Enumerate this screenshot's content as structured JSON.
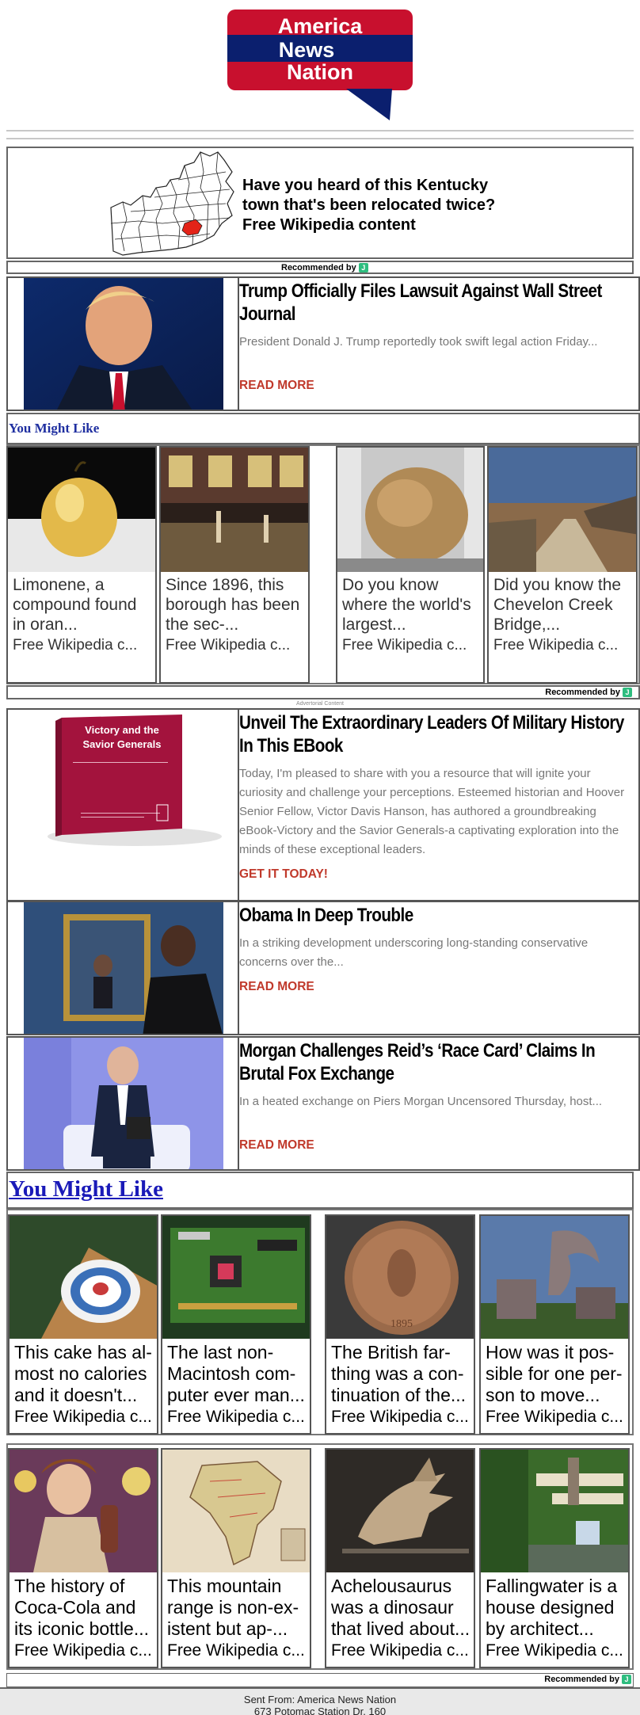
{
  "logo": {
    "line1": "America",
    "line2": "News",
    "line3": "Nation",
    "colors": {
      "red": "#c8102e",
      "navy": "#0b1f6e"
    }
  },
  "promo": {
    "title_line1": "Have you heard of this Kentucky",
    "title_line2": "town that's been relocated twice?",
    "title_line3": "Free Wikipedia content"
  },
  "recommended_by": "Recommended by",
  "articles": [
    {
      "title": "Trump Officially Files Lawsuit Against Wall Street Journal",
      "desc": "President Donald J. Trump reportedly took swift legal action Friday...",
      "cta": "READ MORE"
    }
  ],
  "you_might_like_small": "You Might Like",
  "row1_cards": [
    {
      "text": "Limonene, a compound found in oran...",
      "source": "Free Wikipedia c..."
    },
    {
      "text": "Since 1896, this borough has been the sec-...",
      "source": "Free Wikipedia c..."
    },
    {
      "text": "Do you know where the world's largest...",
      "source": "Free Wikipedia c..."
    },
    {
      "text": "Did you know the Chevelon Creek Bridge,...",
      "source": "Free Wikipedia c..."
    }
  ],
  "advertorial": "Advertorial Content",
  "sponsored": [
    {
      "title": "Unveil The Extraordinary Leaders Of Military History In This EBook",
      "desc": "Today, I'm pleased to share with you a resource that will ignite your curiosity and challenge your perceptions. Esteemed historian and Hoover Senior Fellow, Victor Davis Hanson, has authored a groundbreaking eBook-Victory and the Savior Generals-a captivating exploration into the minds of these exceptional leaders.",
      "cta": "GET IT TODAY!",
      "book_title": "Victory and the Savior Generals"
    },
    {
      "title": "Obama In Deep Trouble",
      "desc": "In a striking development underscoring long-standing conservative concerns over the...",
      "cta": "READ MORE"
    },
    {
      "title": "Morgan Challenges Reid’s ‘Race Card’ Claims In Brutal Fox Exchange",
      "desc": "In a heated exchange on Piers Morgan Uncensored Thursday, host...",
      "cta": "READ MORE"
    }
  ],
  "you_might_like_big": "You Might Like",
  "row2_cards": [
    {
      "text": "This cake has al-most no calories and it doesn't...",
      "source": "Free Wikipedia c..."
    },
    {
      "text": "The last non-Macintosh com-puter ever man...",
      "source": "Free Wikipedia c..."
    },
    {
      "text": "The British far-thing was a con-tinuation of the...",
      "source": "Free Wikipedia c..."
    },
    {
      "text": "How was it pos-sible for one per-son to move...",
      "source": "Free Wikipedia c..."
    }
  ],
  "row3_cards": [
    {
      "text": "The history of Coca-Cola and its iconic bottle...",
      "source": "Free Wikipedia c..."
    },
    {
      "text": "This mountain range is non-ex-istent but ap-...",
      "source": "Free Wikipedia c..."
    },
    {
      "text": "Achelousaurus was a dinosaur that lived about...",
      "source": "Free Wikipedia c..."
    },
    {
      "text": "Fallingwater is a house designed by architect...",
      "source": "Free Wikipedia c..."
    }
  ],
  "coin_text": "1895",
  "footer": {
    "line1": "Sent From: America News Nation",
    "line2": "673 Potomac Station Dr. 160"
  }
}
